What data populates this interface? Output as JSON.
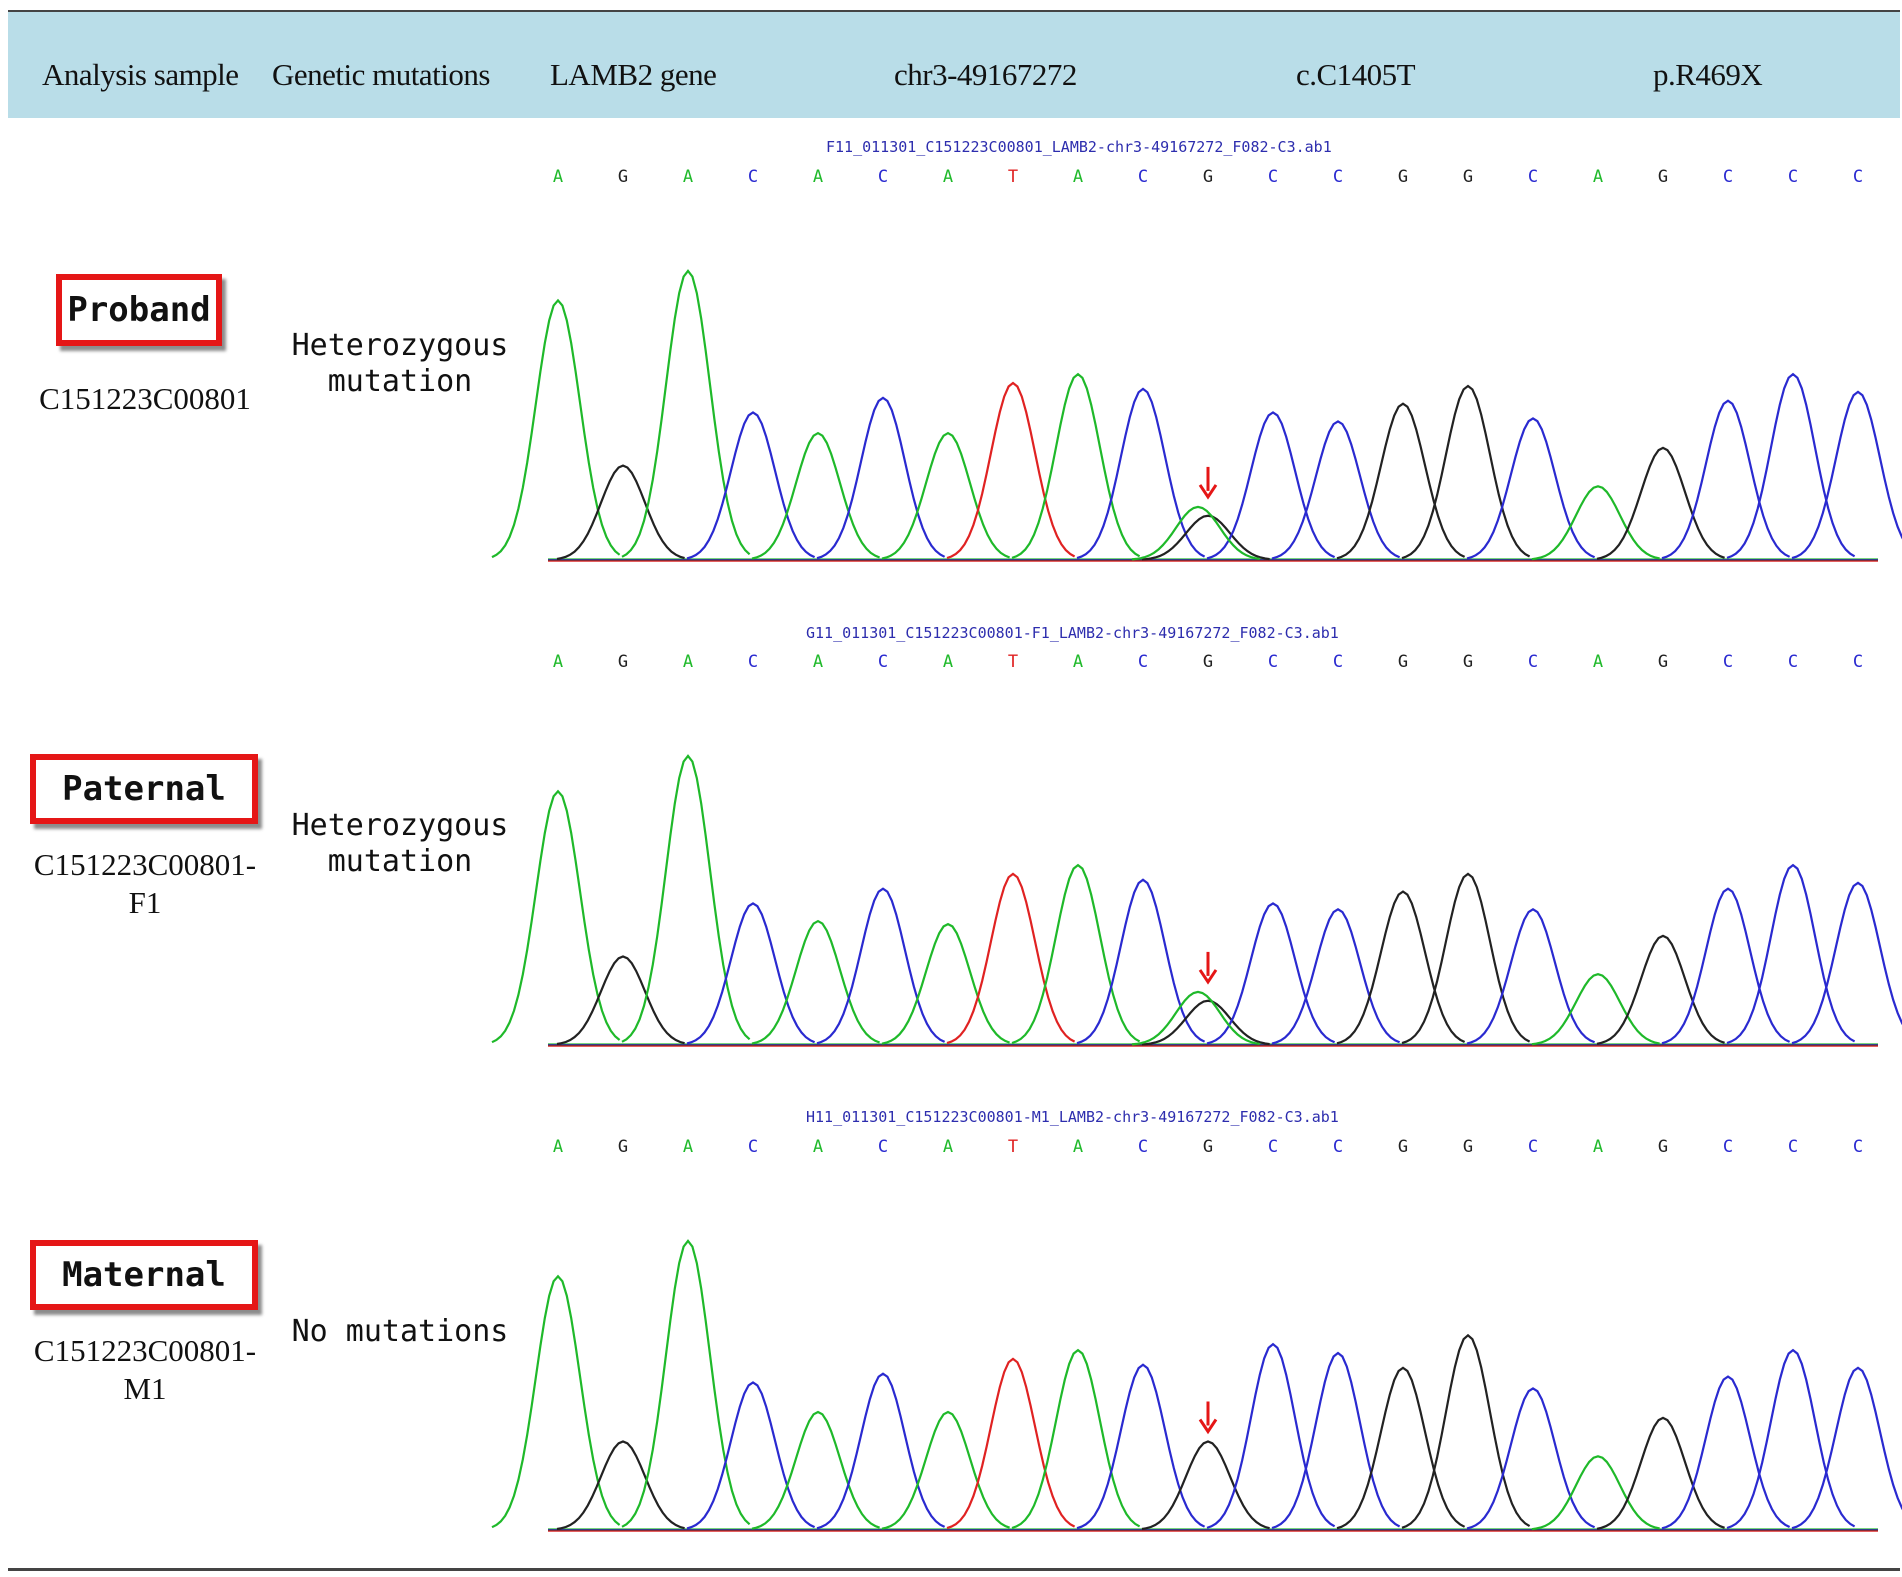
{
  "header": {
    "analysis_sample": "Analysis sample",
    "genetic_mutations": "Genetic mutations",
    "gene": "LAMB2 gene",
    "position": "chr3-49167272",
    "cdna": "c.C1405T",
    "protein": "p.R469X"
  },
  "colors": {
    "A": "#1fb92a",
    "C": "#2a2ad0",
    "G": "#222222",
    "T": "#e02222",
    "label_border": "#e51616",
    "header_bg": "#b9dde8"
  },
  "panels": [
    {
      "label": "Proband",
      "sample_id": "C151223C00801",
      "sample_id_2": "",
      "mutation_line1": "Heterozygous",
      "mutation_line2": "mutation",
      "trace_file": "F11_011301_C151223C00801_LAMB2-chr3-49167272_F082-C3.ab1",
      "bases": [
        "A",
        "G",
        "A",
        "C",
        "A",
        "C",
        "A",
        "T",
        "A",
        "C",
        "G",
        "C",
        "C",
        "G",
        "G",
        "C",
        "A",
        "G",
        "C",
        "C",
        "C"
      ],
      "peaks": [
        0.88,
        0.32,
        0.98,
        0.5,
        0.43,
        0.55,
        0.43,
        0.6,
        0.63,
        0.58,
        0.15,
        0.5,
        0.47,
        0.53,
        0.59,
        0.48,
        0.25,
        0.38,
        0.54,
        0.63,
        0.57
      ],
      "secondary_at": 10,
      "secondary_height": 0.18
    },
    {
      "label": "Paternal",
      "sample_id": "C151223C00801-",
      "sample_id_2": "F1",
      "mutation_line1": "Heterozygous",
      "mutation_line2": "mutation",
      "trace_file": "G11_011301_C151223C00801-F1_LAMB2-chr3-49167272_F082-C3.ab1",
      "bases": [
        "A",
        "G",
        "A",
        "C",
        "A",
        "C",
        "A",
        "T",
        "A",
        "C",
        "G",
        "C",
        "C",
        "G",
        "G",
        "C",
        "A",
        "G",
        "C",
        "C",
        "C"
      ],
      "peaks": [
        0.86,
        0.3,
        0.98,
        0.48,
        0.42,
        0.53,
        0.41,
        0.58,
        0.61,
        0.56,
        0.15,
        0.48,
        0.46,
        0.52,
        0.58,
        0.46,
        0.24,
        0.37,
        0.53,
        0.61,
        0.55
      ],
      "secondary_at": 10,
      "secondary_height": 0.18
    },
    {
      "label": "Maternal",
      "sample_id": "C151223C00801-",
      "sample_id_2": "M1",
      "mutation_line1": "No mutations",
      "mutation_line2": "",
      "trace_file": "H11_011301_C151223C00801-M1_LAMB2-chr3-49167272_F082-C3.ab1",
      "bases": [
        "A",
        "G",
        "A",
        "C",
        "A",
        "C",
        "A",
        "T",
        "A",
        "C",
        "G",
        "C",
        "C",
        "G",
        "G",
        "C",
        "A",
        "G",
        "C",
        "C",
        "C"
      ],
      "peaks": [
        0.86,
        0.3,
        0.98,
        0.5,
        0.4,
        0.53,
        0.4,
        0.58,
        0.61,
        0.56,
        0.3,
        0.63,
        0.6,
        0.55,
        0.66,
        0.48,
        0.25,
        0.38,
        0.52,
        0.61,
        0.55
      ],
      "secondary_at": -1,
      "secondary_height": 0
    }
  ]
}
